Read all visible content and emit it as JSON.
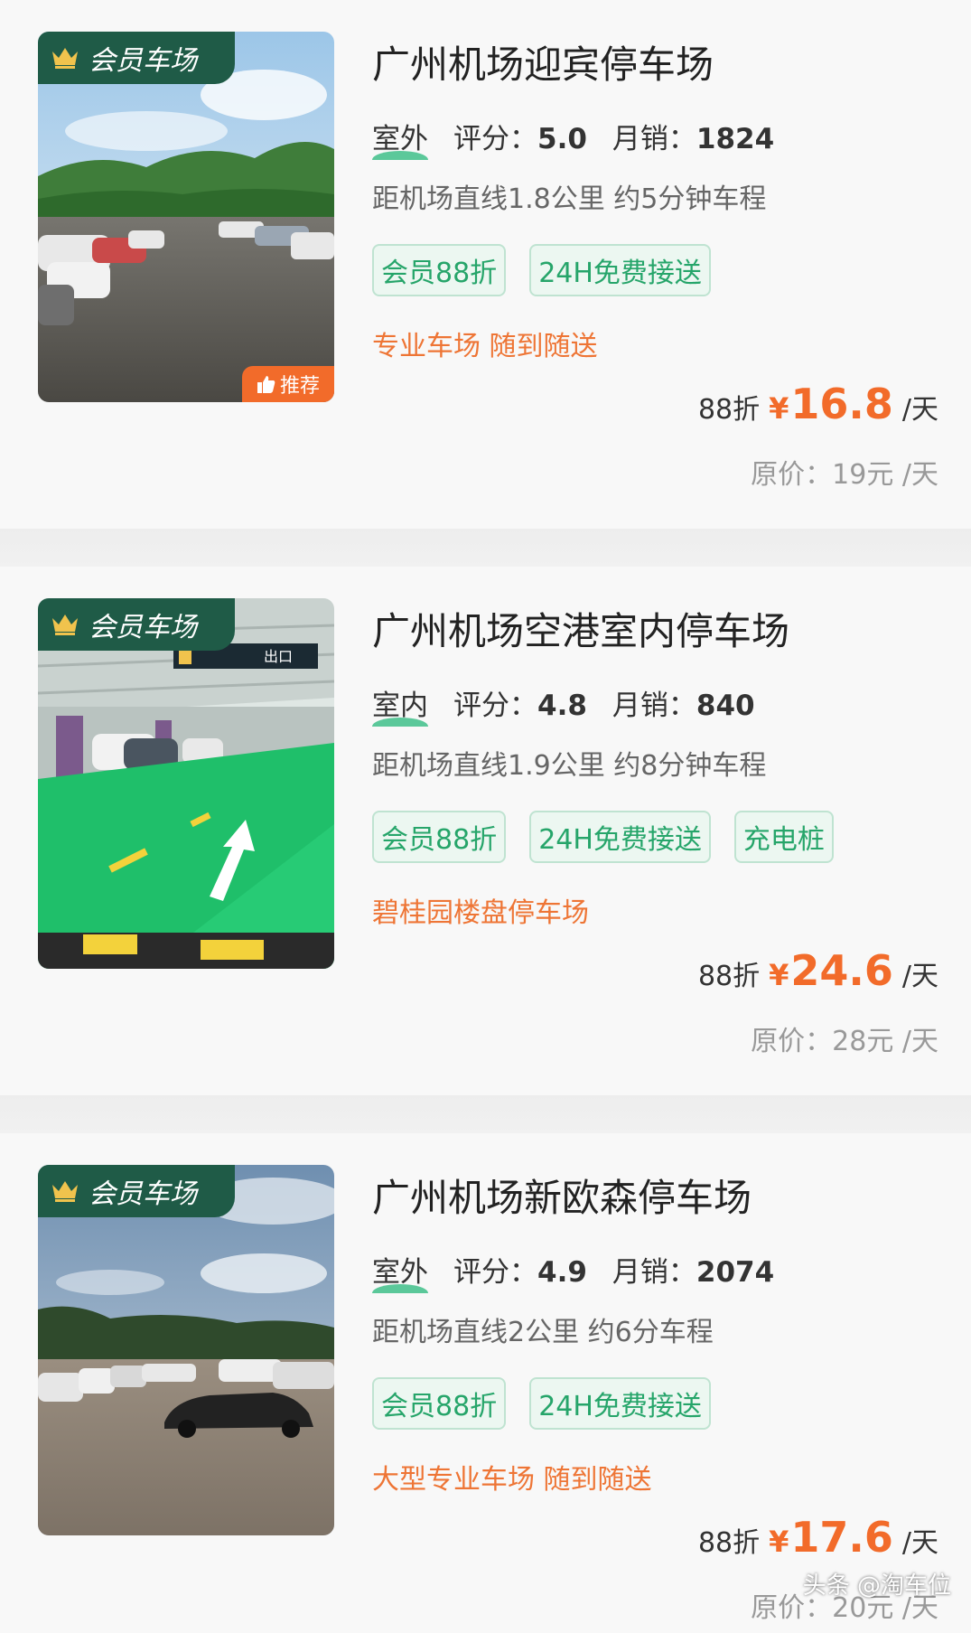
{
  "lots": [
    {
      "badge": "会员车场",
      "recommend": "推荐",
      "title": "广州机场迎宾停车场",
      "type": "室外",
      "rating_label": "评分：",
      "rating": "5.0",
      "sales_label": "月销：",
      "sales": "1824",
      "distance": "距机场直线1.8公里 约5分钟车程",
      "tags": [
        "会员88折",
        "24H免费接送"
      ],
      "features": "专业车场 随到随送",
      "discount": "88折",
      "currency": "¥",
      "price": "16.8",
      "unit": "/天",
      "original": "原价：19元 /天"
    },
    {
      "badge": "会员车场",
      "title": "广州机场空港室内停车场",
      "type": "室内",
      "rating_label": "评分：",
      "rating": "4.8",
      "sales_label": "月销：",
      "sales": "840",
      "distance": "距机场直线1.9公里 约8分钟车程",
      "tags": [
        "会员88折",
        "24H免费接送",
        "充电桩"
      ],
      "features": "碧桂园楼盘停车场",
      "discount": "88折",
      "currency": "¥",
      "price": "24.6",
      "unit": "/天",
      "original": "原价：28元 /天",
      "sign_text": "出口"
    },
    {
      "badge": "会员车场",
      "title": "广州机场新欧森停车场",
      "type": "室外",
      "rating_label": "评分：",
      "rating": "4.9",
      "sales_label": "月销：",
      "sales": "2074",
      "distance": "距机场直线2公里 约6分车程",
      "tags": [
        "会员88折",
        "24H免费接送"
      ],
      "features": "大型专业车场 随到随送",
      "discount": "88折",
      "currency": "¥",
      "price": "17.6",
      "unit": "/天",
      "original": "原价：20元 /天"
    }
  ],
  "watermark": "头条 @淘车位",
  "colors": {
    "member_badge": "#1f5b47",
    "accent_orange": "#f26b2a",
    "tag_green": "#26a56a",
    "tag_bg": "#ecf7f1"
  },
  "icons": {
    "badge": "crown-icon",
    "recommend": "thumbs-up-icon"
  }
}
